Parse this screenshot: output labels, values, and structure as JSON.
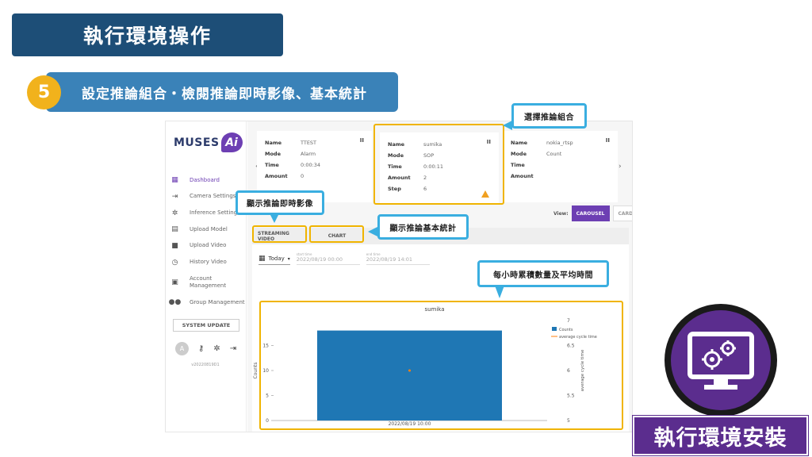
{
  "slide": {
    "title": "執行環境操作",
    "step_number": "5",
    "step_text": "設定推論組合・檢閱推論即時影像、基本統計",
    "install_label": "執行環境安裝"
  },
  "callouts": {
    "select_combo": "選擇推論組合",
    "streaming": "顯示推論即時影像",
    "stats": "顯示推論基本統計",
    "hourly": "每小時累積數量及平均時間"
  },
  "app": {
    "logo": {
      "text": "MUSES",
      "badge": "Ai"
    },
    "nav": [
      {
        "label": "Dashboard",
        "icon": "dashboard-icon",
        "active": true
      },
      {
        "label": "Camera Settings",
        "icon": "camera-settings-icon"
      },
      {
        "label": "Inference Settings",
        "icon": "gear-icon"
      },
      {
        "label": "Upload Model",
        "icon": "document-icon"
      },
      {
        "label": "Upload Video",
        "icon": "video-icon"
      },
      {
        "label": "History Video",
        "icon": "history-icon"
      },
      {
        "label": "Account Management",
        "icon": "account-icon"
      },
      {
        "label": "Group Management",
        "icon": "group-icon"
      }
    ],
    "system_update": "SYSTEM UPDATE",
    "avatar_letter": "A",
    "version": "v20220819D1",
    "cards": [
      {
        "rows": [
          [
            "Name",
            "TTEST"
          ],
          [
            "Mode",
            "Alarm"
          ],
          [
            "Time",
            "0:00:34"
          ],
          [
            "Amount",
            "0"
          ]
        ],
        "status": "II"
      },
      {
        "rows": [
          [
            "Name",
            "sumika"
          ],
          [
            "Mode",
            "SOP"
          ],
          [
            "Time",
            "0:00:11"
          ],
          [
            "Amount",
            "2"
          ],
          [
            "Step",
            "6"
          ]
        ],
        "status": "II",
        "warning": true
      },
      {
        "rows": [
          [
            "Name",
            "nokia_rtsp"
          ],
          [
            "Mode",
            "Count"
          ],
          [
            "Time",
            ""
          ],
          [
            "Amount",
            ""
          ]
        ],
        "status": "II"
      }
    ],
    "view": {
      "label": "View:",
      "carousel": "CAROUSEL",
      "card": "CARD"
    },
    "tabs": {
      "streaming": "STREAMING VIDEO",
      "chart": "CHART"
    },
    "date": {
      "range": "Today",
      "start_label": "start time",
      "start_value": "2022/08/19 00:00",
      "end_label": "end time",
      "end_value": "2022/08/19 14:01"
    }
  },
  "chart_data": {
    "type": "bar",
    "title": "sumika",
    "categories": [
      "2022/08/19 10:00"
    ],
    "series": [
      {
        "name": "Counts",
        "values": [
          18
        ],
        "color": "#1f77b4",
        "axis": "left"
      },
      {
        "name": "average cycle time",
        "values": [
          6
        ],
        "color": "#ff7f0e",
        "axis": "right",
        "kind": "line"
      }
    ],
    "ylabel": "Counts",
    "y2label": "average cycle time",
    "ylim": [
      0,
      20
    ],
    "y2lim": [
      5,
      7
    ],
    "yticks": [
      0,
      5,
      10,
      15
    ],
    "y2ticks": [
      5,
      5.5,
      6,
      6.5,
      7
    ],
    "legend": "top-right"
  }
}
